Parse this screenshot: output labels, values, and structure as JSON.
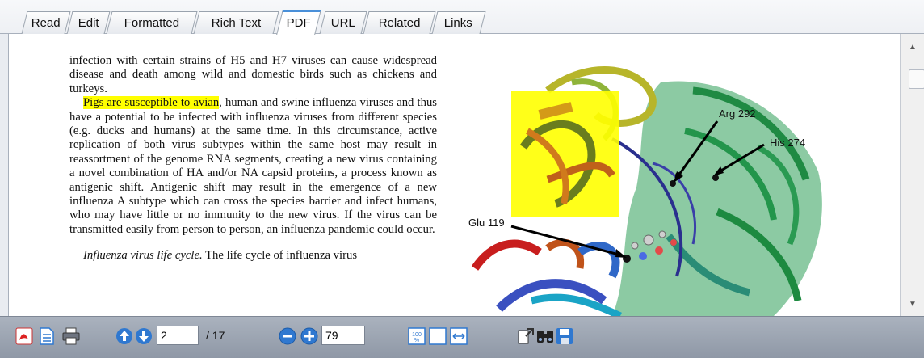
{
  "tabs": [
    {
      "label": "Read"
    },
    {
      "label": "Edit"
    },
    {
      "label": "Formatted"
    },
    {
      "label": "Rich Text"
    },
    {
      "label": "PDF"
    },
    {
      "label": "URL"
    },
    {
      "label": "Related"
    },
    {
      "label": "Links"
    }
  ],
  "active_tab": "PDF",
  "document": {
    "para1": "infection with certain strains of H5 and H7 viruses can cause widespread disease and death among wild and domestic birds such as chickens and turkeys.",
    "para2_highlight": "Pigs are susceptible to avian",
    "para2_rest": ", human and swine influenza viruses and thus have a potential to be infected with influenza viruses from different species (e.g. ducks and humans) at the same time. In this circumstance, active replication of both virus subtypes within the same host may result in reassortment of the genome RNA segments, creating a new virus containing a novel combination of HA and/or NA capsid proteins, a process known as antigenic shift. Antigenic shift may result in the emergence of a new influenza A subtype which can cross the species barrier and infect humans, who may have little or no immunity to the new virus. If the virus can be transmitted easily from person to person, an influenza pandemic could occur.",
    "para3_italic": "Influenza virus life cycle.",
    "para3_rest": " The life cycle of influenza virus",
    "highlight_color": "#ffff00"
  },
  "figure": {
    "labels": {
      "arg": "Arg 292",
      "his": "His 274",
      "glu": "Glu 119"
    }
  },
  "toolbar": {
    "page_value": "2",
    "page_total": "/ 17",
    "zoom_value": "79",
    "icons": [
      "pdf-icon",
      "document-icon",
      "print-icon",
      "page-up-icon",
      "page-down-icon",
      "zoom-out-icon",
      "zoom-in-icon",
      "actual-size-icon",
      "fit-page-icon",
      "fit-width-icon",
      "export-icon",
      "find-icon",
      "save-icon"
    ]
  },
  "colors": {
    "toolbar": "#9aa2ae",
    "active_tab_accent": "#4a90d9",
    "icon_blue": "#2f78d0"
  }
}
